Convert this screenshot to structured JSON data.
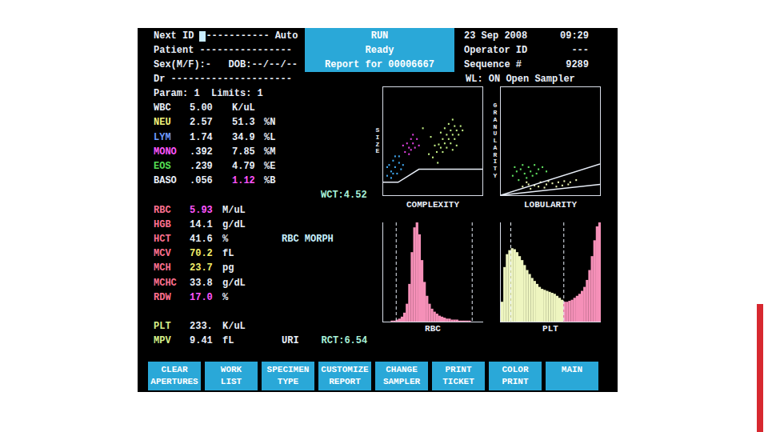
{
  "header": {
    "next_id": {
      "label": "Next ID",
      "value": "-----------",
      "mode": "Auto"
    },
    "patient": "Patient ----------------",
    "sex_dob": "Sex(M/F):-   DOB:--/--/--",
    "doctor": "Dr ---------------------",
    "status": [
      "RUN",
      "Ready",
      "Report for 00006667"
    ],
    "date": "23 Sep 2008",
    "time": "09:29",
    "operator": {
      "label": "Operator ID",
      "value": "---"
    },
    "sequence": {
      "label": "Sequence #",
      "value": "9289"
    },
    "wl_status": "WL: ON Open Sampler"
  },
  "params": "Param: 1  Limits: 1",
  "wbc_rows": [
    {
      "label": "WBC",
      "color": "#e8eef8",
      "value": "5.00",
      "flag": "none",
      "unit": "K/uL"
    },
    {
      "label": "NEU",
      "color": "#f2f27a",
      "value": "2.57",
      "flag": "none",
      "percent": "51.3",
      "percent_flag": "none",
      "unit": "%N"
    },
    {
      "label": "LYM",
      "color": "#6f9bff",
      "value": "1.74",
      "flag": "none",
      "percent": "34.9",
      "percent_flag": "none",
      "unit": "%L"
    },
    {
      "label": "MONO",
      "color": "#ff55ff",
      "value": ".392",
      "flag": "none",
      "percent": "7.85",
      "percent_flag": "none",
      "unit": "%M"
    },
    {
      "label": "EOS",
      "color": "#55e055",
      "value": ".239",
      "flag": "none",
      "percent": "4.79",
      "percent_flag": "none",
      "unit": "%E"
    },
    {
      "label": "BASO",
      "color": "#e8eef8",
      "value": ".056",
      "flag": "none",
      "percent": "1.12",
      "percent_flag": "high",
      "unit": "%B"
    }
  ],
  "wct": "WCT:4.52",
  "rbc_rows": [
    {
      "label": "RBC",
      "color": "#ff7090",
      "value": "5.93",
      "flag": "high",
      "unit": "M/uL"
    },
    {
      "label": "HGB",
      "color": "#ff7090",
      "value": "14.1",
      "flag": "none",
      "unit": "g/dL"
    },
    {
      "label": "HCT",
      "color": "#ff7090",
      "value": "41.6",
      "flag": "none",
      "unit": "%"
    },
    {
      "label": "MCV",
      "color": "#ff7090",
      "value": "70.2",
      "flag": "low",
      "unit": "fL"
    },
    {
      "label": "MCH",
      "color": "#ff7090",
      "value": "23.7",
      "flag": "low",
      "unit": "pg"
    },
    {
      "label": "MCHC",
      "color": "#ff7090",
      "value": "33.8",
      "flag": "none",
      "unit": "g/dL"
    },
    {
      "label": "RDW",
      "color": "#ff7090",
      "value": "17.0",
      "flag": "high",
      "unit": "%"
    }
  ],
  "rbc_morph": "RBC MORPH",
  "plt_rows": [
    {
      "label": "PLT",
      "color": "#d8f08a",
      "value": "233.",
      "flag": "none",
      "unit": "K/uL"
    },
    {
      "label": "MPV",
      "color": "#d8f08a",
      "value": "9.41",
      "flag": "none",
      "unit": "fL"
    }
  ],
  "uri": "URI",
  "rct": "RCT:6.54",
  "scatter_plots": [
    {
      "y_label": "SIZE",
      "x_label": "COMPLEXITY",
      "gates": [
        [
          [
            0,
            12
          ],
          [
            15,
            12
          ],
          [
            36,
            24
          ],
          [
            100,
            24
          ]
        ]
      ],
      "series": [
        {
          "color": "#c2ee84",
          "points": [
            [
              50,
              35
            ],
            [
              54,
              40
            ],
            [
              58,
              44
            ],
            [
              62,
              48
            ],
            [
              66,
              52
            ],
            [
              70,
              56
            ],
            [
              74,
              60
            ],
            [
              78,
              64
            ],
            [
              56,
              47
            ],
            [
              60,
              52
            ],
            [
              64,
              56
            ],
            [
              68,
              60
            ],
            [
              72,
              64
            ],
            [
              60,
              40
            ],
            [
              64,
              44
            ],
            [
              68,
              48
            ],
            [
              72,
              52
            ],
            [
              76,
              56
            ],
            [
              80,
              60
            ],
            [
              66,
              66
            ],
            [
              70,
              70
            ],
            [
              58,
              58
            ],
            [
              52,
              46
            ],
            [
              74,
              46
            ],
            [
              62,
              62
            ],
            [
              46,
              38
            ],
            [
              55,
              30
            ],
            [
              70,
              42
            ],
            [
              48,
              54
            ],
            [
              40,
              62
            ]
          ]
        },
        {
          "color": "#e040e0",
          "points": [
            [
              22,
              40
            ],
            [
              26,
              44
            ],
            [
              30,
              48
            ],
            [
              24,
              48
            ],
            [
              28,
              52
            ],
            [
              32,
              44
            ],
            [
              34,
              52
            ],
            [
              26,
              38
            ],
            [
              30,
              56
            ],
            [
              36,
              46
            ],
            [
              20,
              46
            ],
            [
              28,
              42
            ]
          ]
        },
        {
          "color": "#40a8f0",
          "points": [
            [
              4,
              18
            ],
            [
              8,
              22
            ],
            [
              12,
              26
            ],
            [
              6,
              28
            ],
            [
              10,
              32
            ],
            [
              14,
              20
            ],
            [
              16,
              30
            ],
            [
              18,
              24
            ],
            [
              8,
              16
            ],
            [
              12,
              36
            ],
            [
              4,
              26
            ],
            [
              16,
              36
            ],
            [
              20,
              28
            ],
            [
              10,
              20
            ]
          ]
        }
      ]
    },
    {
      "y_label": "GRANULARITY",
      "x_label": "LOBULARITY",
      "gates": [
        [
          [
            0,
            0
          ],
          [
            100,
            29
          ]
        ],
        [
          [
            0,
            0
          ],
          [
            100,
            10
          ]
        ]
      ],
      "series": [
        {
          "color": "#60e060",
          "points": [
            [
              12,
              18
            ],
            [
              16,
              22
            ],
            [
              20,
              24
            ],
            [
              24,
              20
            ],
            [
              28,
              26
            ],
            [
              18,
              14
            ],
            [
              30,
              22
            ],
            [
              34,
              28
            ],
            [
              22,
              28
            ],
            [
              26,
              16
            ],
            [
              38,
              24
            ],
            [
              42,
              26
            ],
            [
              14,
              26
            ],
            [
              32,
              18
            ],
            [
              46,
              22
            ],
            [
              36,
              20
            ]
          ]
        },
        {
          "color": "#e8f0b0",
          "points": [
            [
              22,
              8
            ],
            [
              28,
              10
            ],
            [
              34,
              9
            ],
            [
              40,
              12
            ],
            [
              46,
              10
            ],
            [
              52,
              11
            ],
            [
              58,
              12
            ],
            [
              64,
              13
            ],
            [
              70,
              12
            ],
            [
              76,
              14
            ],
            [
              30,
              6
            ],
            [
              44,
              7
            ],
            [
              56,
              8
            ],
            [
              62,
              9
            ],
            [
              48,
              13
            ],
            [
              38,
              8
            ],
            [
              68,
              10
            ],
            [
              26,
              12
            ]
          ]
        }
      ]
    }
  ],
  "histograms": [
    {
      "x_label": "RBC",
      "markers": [
        13,
        89
      ],
      "series": [
        {
          "color": "#f590b8",
          "start": 0,
          "values": [
            0,
            0,
            0,
            1,
            1,
            2,
            3,
            5,
            9,
            18,
            38,
            70,
            95,
            100,
            88,
            62,
            40,
            26,
            18,
            13,
            10,
            8,
            6,
            5,
            4,
            3,
            3,
            2,
            2,
            2,
            1,
            1,
            1,
            1,
            1,
            0,
            0,
            0,
            0,
            0
          ]
        }
      ]
    },
    {
      "x_label": "PLT",
      "markers": [
        10,
        63
      ],
      "series": [
        {
          "color": "#eef5c0",
          "start": 0,
          "values": [
            20,
            55,
            68,
            72,
            74,
            73,
            70,
            66,
            62,
            57,
            52,
            48,
            44,
            41,
            38,
            35,
            33,
            32,
            31,
            30,
            29,
            28,
            26,
            24,
            22
          ]
        },
        {
          "color": "#f590b8",
          "start": 25,
          "values": [
            20,
            20,
            21,
            22,
            24,
            26,
            28,
            31,
            35,
            42,
            52,
            66,
            82,
            96,
            100
          ]
        }
      ]
    }
  ],
  "buttons": [
    {
      "lines": [
        "CLEAR",
        "APERTURES"
      ]
    },
    {
      "lines": [
        "WORK",
        "LIST"
      ]
    },
    {
      "lines": [
        "SPECIMEN",
        "TYPE"
      ]
    },
    {
      "lines": [
        "CUSTOMIZE",
        "REPORT"
      ]
    },
    {
      "lines": [
        "CHANGE",
        "SAMPLER"
      ]
    },
    {
      "lines": [
        "PRINT",
        "TICKET"
      ]
    },
    {
      "lines": [
        "COLOR",
        "PRINT"
      ]
    },
    {
      "lines": [
        "MAIN"
      ]
    }
  ]
}
